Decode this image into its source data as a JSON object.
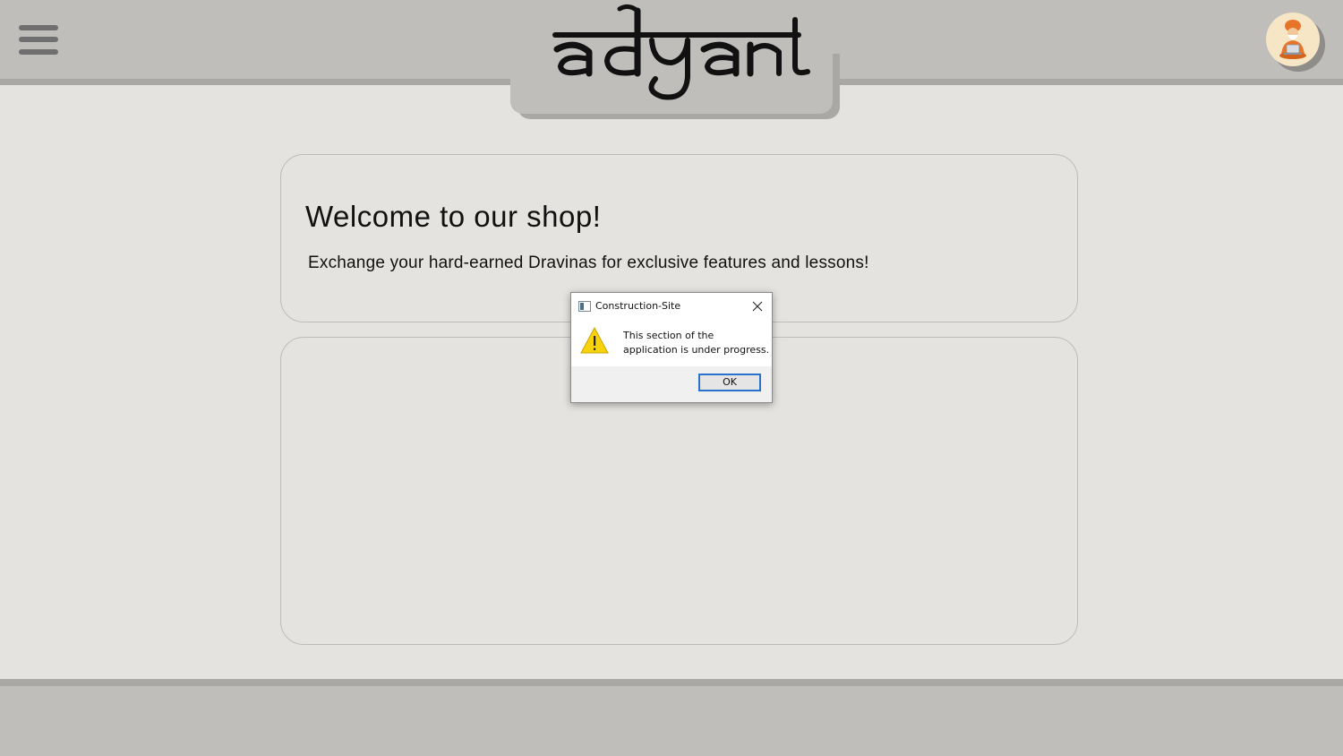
{
  "header": {
    "logo_text": "adyant",
    "menu_icon": "hamburger-menu-icon",
    "avatar_icon": "sage-with-laptop-avatar"
  },
  "shop": {
    "title": "Welcome to our shop!",
    "subtitle": "Exchange your hard-earned Dravinas for exclusive features and lessons!"
  },
  "dialog": {
    "title": "Construction-Site",
    "message": "This section of the application is under progress.",
    "ok_label": "OK",
    "icon": "warning-icon"
  },
  "colors": {
    "header_bg": "#bfbebb",
    "page_bg": "#e4e3df",
    "accent_border": "#a9a8a5",
    "button_focus": "#2a72c9",
    "warning_yellow": "#f8d30c"
  }
}
